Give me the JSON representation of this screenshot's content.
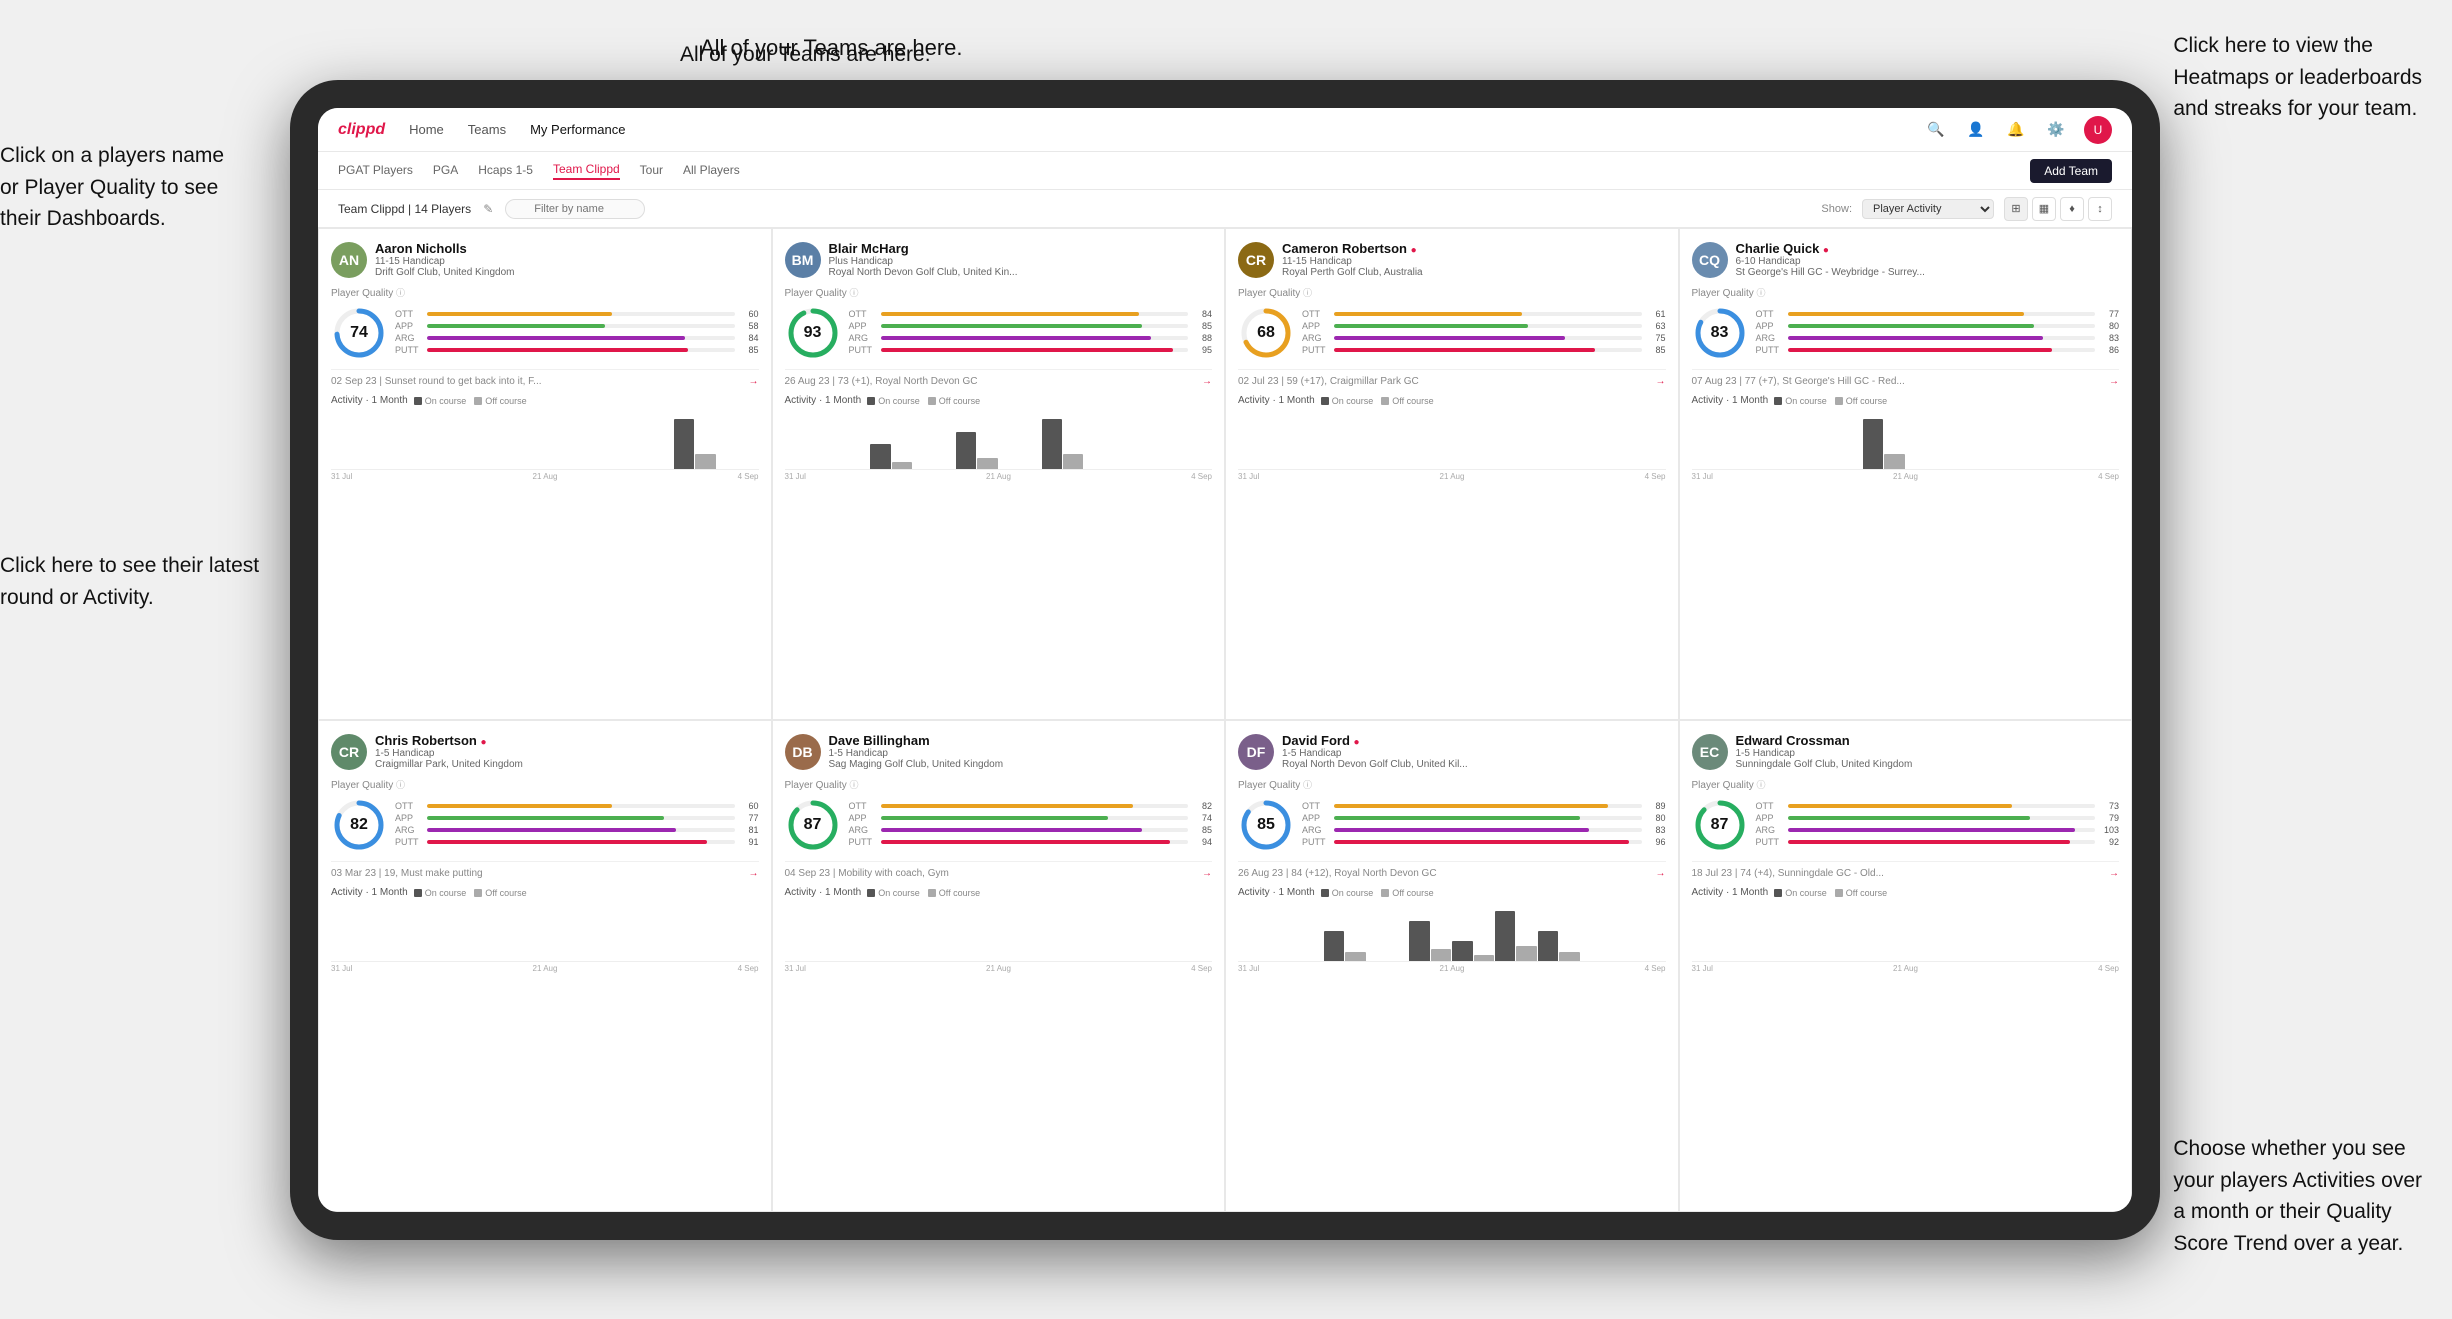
{
  "annotations": {
    "top_left": "Click on a players name\nor Player Quality to see\ntheir Dashboards.",
    "bottom_left": "Click here to see their latest\nround or Activity.",
    "top_center": "All of your Teams are here.",
    "top_right_1": "Click here to view the\nHeatmaps or leaderboards\nand streaks for your team.",
    "bottom_right": "Choose whether you see\nyour players Activities over\na month or their Quality\nScore Trend over a year."
  },
  "nav": {
    "logo": "clippd",
    "links": [
      "Home",
      "Teams",
      "My Performance"
    ],
    "active": "Teams"
  },
  "subnav": {
    "links": [
      "PGAT Players",
      "PGA",
      "Hcaps 1-5",
      "Team Clippd",
      "Tour",
      "All Players"
    ],
    "active": "Team Clippd",
    "add_team": "Add Team"
  },
  "teambar": {
    "title": "Team Clippd | 14 Players",
    "filter_placeholder": "Filter by name",
    "show_label": "Show:",
    "show_value": "Player Activity",
    "view_modes": [
      "grid-2x2",
      "grid-3x3",
      "filter",
      "sort"
    ]
  },
  "players": [
    {
      "name": "Aaron Nicholls",
      "handicap": "11-15 Handicap",
      "club": "Drift Golf Club, United Kingdom",
      "avatar_color": "#7a9e5f",
      "avatar_initials": "AN",
      "quality": 74,
      "quality_color": "#3b8fe0",
      "stats": [
        {
          "name": "OTT",
          "color": "#e8a020",
          "value": 60,
          "max": 100
        },
        {
          "name": "APP",
          "color": "#4caf50",
          "value": 58,
          "max": 100
        },
        {
          "name": "ARG",
          "color": "#9c27b0",
          "value": 84,
          "max": 100
        },
        {
          "name": "PUTT",
          "color": "#e0174a",
          "value": 85,
          "max": 100
        }
      ],
      "latest_round": "02 Sep 23 | Sunset round to get back into it, F...",
      "activity_bars": [
        0,
        0,
        0,
        0,
        0,
        0,
        0,
        0,
        1,
        0
      ],
      "chart_labels": [
        "31 Jul",
        "21 Aug",
        "4 Sep"
      ]
    },
    {
      "name": "Blair McHarg",
      "handicap": "Plus Handicap",
      "club": "Royal North Devon Golf Club, United Kin...",
      "avatar_color": "#5b7fa6",
      "avatar_initials": "BM",
      "quality": 93,
      "quality_color": "#27ae60",
      "stats": [
        {
          "name": "OTT",
          "color": "#e8a020",
          "value": 84,
          "max": 100
        },
        {
          "name": "APP",
          "color": "#4caf50",
          "value": 85,
          "max": 100
        },
        {
          "name": "ARG",
          "color": "#9c27b0",
          "value": 88,
          "max": 100
        },
        {
          "name": "PUTT",
          "color": "#e0174a",
          "value": 95,
          "max": 100
        }
      ],
      "latest_round": "26 Aug 23 | 73 (+1), Royal North Devon GC",
      "activity_bars": [
        0,
        0,
        2,
        0,
        3,
        0,
        4,
        0,
        0,
        0
      ],
      "chart_labels": [
        "31 Jul",
        "21 Aug",
        "4 Sep"
      ]
    },
    {
      "name": "Cameron Robertson",
      "handicap": "11-15 Handicap",
      "club": "Royal Perth Golf Club, Australia",
      "avatar_color": "#8b6914",
      "avatar_initials": "CR",
      "quality": 68,
      "quality_color": "#e8a020",
      "verified": true,
      "stats": [
        {
          "name": "OTT",
          "color": "#e8a020",
          "value": 61,
          "max": 100
        },
        {
          "name": "APP",
          "color": "#4caf50",
          "value": 63,
          "max": 100
        },
        {
          "name": "ARG",
          "color": "#9c27b0",
          "value": 75,
          "max": 100
        },
        {
          "name": "PUTT",
          "color": "#e0174a",
          "value": 85,
          "max": 100
        }
      ],
      "latest_round": "02 Jul 23 | 59 (+17), Craigmillar Park GC",
      "activity_bars": [
        0,
        0,
        0,
        0,
        0,
        0,
        0,
        0,
        0,
        0
      ],
      "chart_labels": [
        "31 Jul",
        "21 Aug",
        "4 Sep"
      ]
    },
    {
      "name": "Charlie Quick",
      "handicap": "6-10 Handicap",
      "club": "St George's Hill GC - Weybridge - Surrey...",
      "avatar_color": "#6a8caf",
      "avatar_initials": "CQ",
      "quality": 83,
      "quality_color": "#3b8fe0",
      "verified": true,
      "stats": [
        {
          "name": "OTT",
          "color": "#e8a020",
          "value": 77,
          "max": 100
        },
        {
          "name": "APP",
          "color": "#4caf50",
          "value": 80,
          "max": 100
        },
        {
          "name": "ARG",
          "color": "#9c27b0",
          "value": 83,
          "max": 100
        },
        {
          "name": "PUTT",
          "color": "#e0174a",
          "value": 86,
          "max": 100
        }
      ],
      "latest_round": "07 Aug 23 | 77 (+7), St George's Hill GC - Red...",
      "activity_bars": [
        0,
        0,
        0,
        0,
        1,
        0,
        0,
        0,
        0,
        0
      ],
      "chart_labels": [
        "31 Jul",
        "21 Aug",
        "4 Sep"
      ]
    },
    {
      "name": "Chris Robertson",
      "handicap": "1-5 Handicap",
      "club": "Craigmillar Park, United Kingdom",
      "avatar_color": "#5f8a6a",
      "avatar_initials": "CR",
      "quality": 82,
      "quality_color": "#3b8fe0",
      "verified": true,
      "stats": [
        {
          "name": "OTT",
          "color": "#e8a020",
          "value": 60,
          "max": 100
        },
        {
          "name": "APP",
          "color": "#4caf50",
          "value": 77,
          "max": 100
        },
        {
          "name": "ARG",
          "color": "#9c27b0",
          "value": 81,
          "max": 100
        },
        {
          "name": "PUTT",
          "color": "#e0174a",
          "value": 91,
          "max": 100
        }
      ],
      "latest_round": "03 Mar 23 | 19, Must make putting",
      "activity_bars": [
        0,
        0,
        0,
        0,
        0,
        0,
        0,
        0,
        0,
        0
      ],
      "chart_labels": [
        "31 Jul",
        "21 Aug",
        "4 Sep"
      ]
    },
    {
      "name": "Dave Billingham",
      "handicap": "1-5 Handicap",
      "club": "Sag Maging Golf Club, United Kingdom",
      "avatar_color": "#9a6b4b",
      "avatar_initials": "DB",
      "quality": 87,
      "quality_color": "#27ae60",
      "stats": [
        {
          "name": "OTT",
          "color": "#e8a020",
          "value": 82,
          "max": 100
        },
        {
          "name": "APP",
          "color": "#4caf50",
          "value": 74,
          "max": 100
        },
        {
          "name": "ARG",
          "color": "#9c27b0",
          "value": 85,
          "max": 100
        },
        {
          "name": "PUTT",
          "color": "#e0174a",
          "value": 94,
          "max": 100
        }
      ],
      "latest_round": "04 Sep 23 | Mobility with coach, Gym",
      "activity_bars": [
        0,
        0,
        0,
        0,
        0,
        0,
        0,
        0,
        0,
        0
      ],
      "chart_labels": [
        "31 Jul",
        "21 Aug",
        "4 Sep"
      ]
    },
    {
      "name": "David Ford",
      "handicap": "1-5 Handicap",
      "club": "Royal North Devon Golf Club, United Kil...",
      "avatar_color": "#7a5f8a",
      "avatar_initials": "DF",
      "quality": 85,
      "quality_color": "#3b8fe0",
      "verified": true,
      "stats": [
        {
          "name": "OTT",
          "color": "#e8a020",
          "value": 89,
          "max": 100
        },
        {
          "name": "APP",
          "color": "#4caf50",
          "value": 80,
          "max": 100
        },
        {
          "name": "ARG",
          "color": "#9c27b0",
          "value": 83,
          "max": 100
        },
        {
          "name": "PUTT",
          "color": "#e0174a",
          "value": 96,
          "max": 100
        }
      ],
      "latest_round": "26 Aug 23 | 84 (+12), Royal North Devon GC",
      "activity_bars": [
        0,
        0,
        3,
        0,
        4,
        2,
        5,
        3,
        0,
        0
      ],
      "chart_labels": [
        "31 Jul",
        "21 Aug",
        "4 Sep"
      ]
    },
    {
      "name": "Edward Crossman",
      "handicap": "1-5 Handicap",
      "club": "Sunningdale Golf Club, United Kingdom",
      "avatar_color": "#6b8a7a",
      "avatar_initials": "EC",
      "quality": 87,
      "quality_color": "#27ae60",
      "stats": [
        {
          "name": "OTT",
          "color": "#e8a020",
          "value": 73,
          "max": 100
        },
        {
          "name": "APP",
          "color": "#4caf50",
          "value": 79,
          "max": 100
        },
        {
          "name": "ARG",
          "color": "#9c27b0",
          "value": 103,
          "max": 110
        },
        {
          "name": "PUTT",
          "color": "#e0174a",
          "value": 92,
          "max": 100
        }
      ],
      "latest_round": "18 Jul 23 | 74 (+4), Sunningdale GC - Old...",
      "activity_bars": [
        0,
        0,
        0,
        0,
        0,
        0,
        0,
        0,
        0,
        0
      ],
      "chart_labels": [
        "31 Jul",
        "21 Aug",
        "4 Sep"
      ]
    }
  ]
}
